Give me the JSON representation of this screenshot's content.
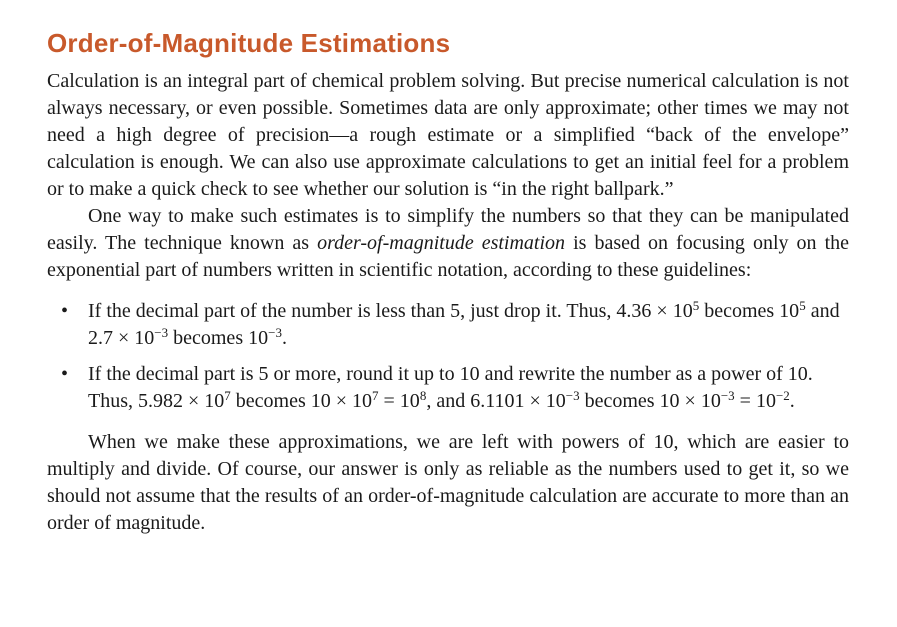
{
  "title": "Order-of-Magnitude Estimations",
  "paragraph1": "Calculation is an integral part of chemical problem solving. But precise numerical calculation is not always necessary, or even possible. Sometimes data are only approximate; other times we may not need a high degree of precision—a rough estimate or a simplified “back of the envelope” calculation is enough. We can also use approximate calculations to get an initial feel for a problem or to make a quick check to see whether our solution is “in the right ballpark.”",
  "paragraph2": {
    "before": "One way to make such estimates is to simplify the numbers so that they can be manipulated easily. The technique known as ",
    "term": "order-of-magnitude estimation",
    "after": " is based on focusing only on the exponential part of numbers written in scientific notation, according to these guidelines:"
  },
  "bullet_marker": "•",
  "bullet1": {
    "t1": "If the decimal part of the number is less than 5, just drop it. Thus, 4.36 × 10",
    "s1": "5",
    "t2": " becomes 10",
    "s2": "5",
    "t3": " and 2.7 × 10",
    "s3": "−3",
    "t4": " becomes 10",
    "s4": "−3",
    "t5": "."
  },
  "bullet2": {
    "t1": "If the decimal part is 5 or more, round it up to 10 and rewrite the number as a power of 10. Thus, 5.982 × 10",
    "s1": "7",
    "t2": " becomes 10 × 10",
    "s2": "7",
    "t3": " = 10",
    "s3": "8",
    "t4": ", and 6.1101 × 10",
    "s4": "−3",
    "t5": " becomes 10 × 10",
    "s5": "−3",
    "t6": " = 10",
    "s6": "−2",
    "t7": "."
  },
  "paragraph3": "When we make these approximations, we are left with powers of 10, which are easier to multiply and divide. Of course, our answer is only as reliable as the numbers used to get it, so we should not assume that the results of an order-of-magnitude calculation are accurate to more than an order of magnitude.",
  "colors": {
    "title": "#c8592b",
    "text": "#1a1a1a"
  }
}
